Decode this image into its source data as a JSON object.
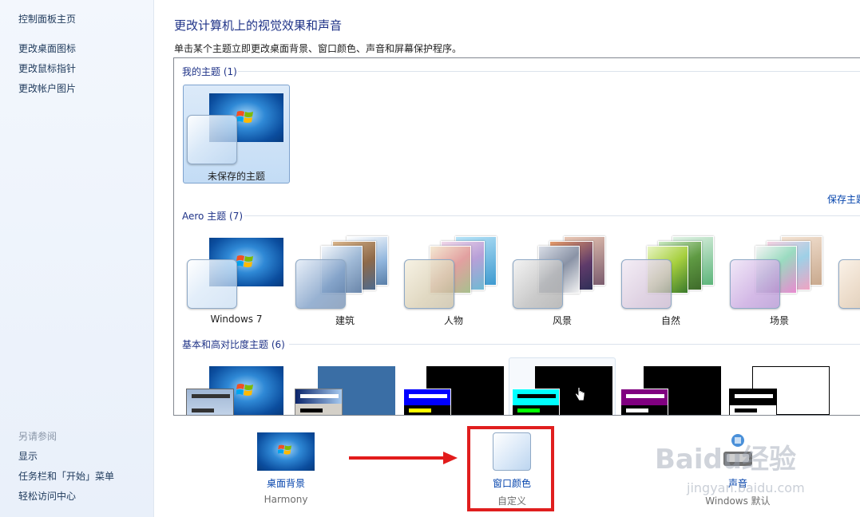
{
  "left_pane": {
    "home": "控制面板主页",
    "links": [
      "更改桌面图标",
      "更改鼠标指针",
      "更改帐户图片"
    ],
    "see_also_title": "另请参阅",
    "see_also": [
      "显示",
      "任务栏和「开始」菜单",
      "轻松访问中心"
    ]
  },
  "main": {
    "title": "更改计算机上的视觉效果和声音",
    "description": "单击某个主题立即更改桌面背景、窗口颜色、声音和屏幕保护程序。",
    "save_theme_link": "保存主题"
  },
  "groups": {
    "my_themes": {
      "label": "我的主题 (1)",
      "items": [
        {
          "label": "未保存的主题",
          "selected": true
        }
      ]
    },
    "aero_themes": {
      "label": "Aero 主题 (7)",
      "items": [
        {
          "label": "Windows 7"
        },
        {
          "label": "建筑"
        },
        {
          "label": "人物"
        },
        {
          "label": "风景"
        },
        {
          "label": "自然"
        },
        {
          "label": "场景"
        }
      ]
    },
    "basic_themes": {
      "label": "基本和高对比度主题 (6)"
    }
  },
  "bottom": {
    "desktop_background": {
      "label": "桌面背景",
      "value": "Harmony"
    },
    "window_color": {
      "label": "窗口颜色",
      "value": "自定义"
    },
    "sounds": {
      "label": "声音",
      "value": "Windows 默认"
    }
  },
  "watermark": {
    "brand": "Baidu经验",
    "url": "jingyan.baidu.com"
  },
  "colors": {
    "accent": "#1e3287",
    "link": "#0645ad",
    "highlight_box": "#e01e1e",
    "selected_theme": "#c3dcf5"
  },
  "icons": [
    "windows-flag-icon",
    "arrow-right-icon",
    "sound-icon",
    "hand-cursor-icon"
  ]
}
